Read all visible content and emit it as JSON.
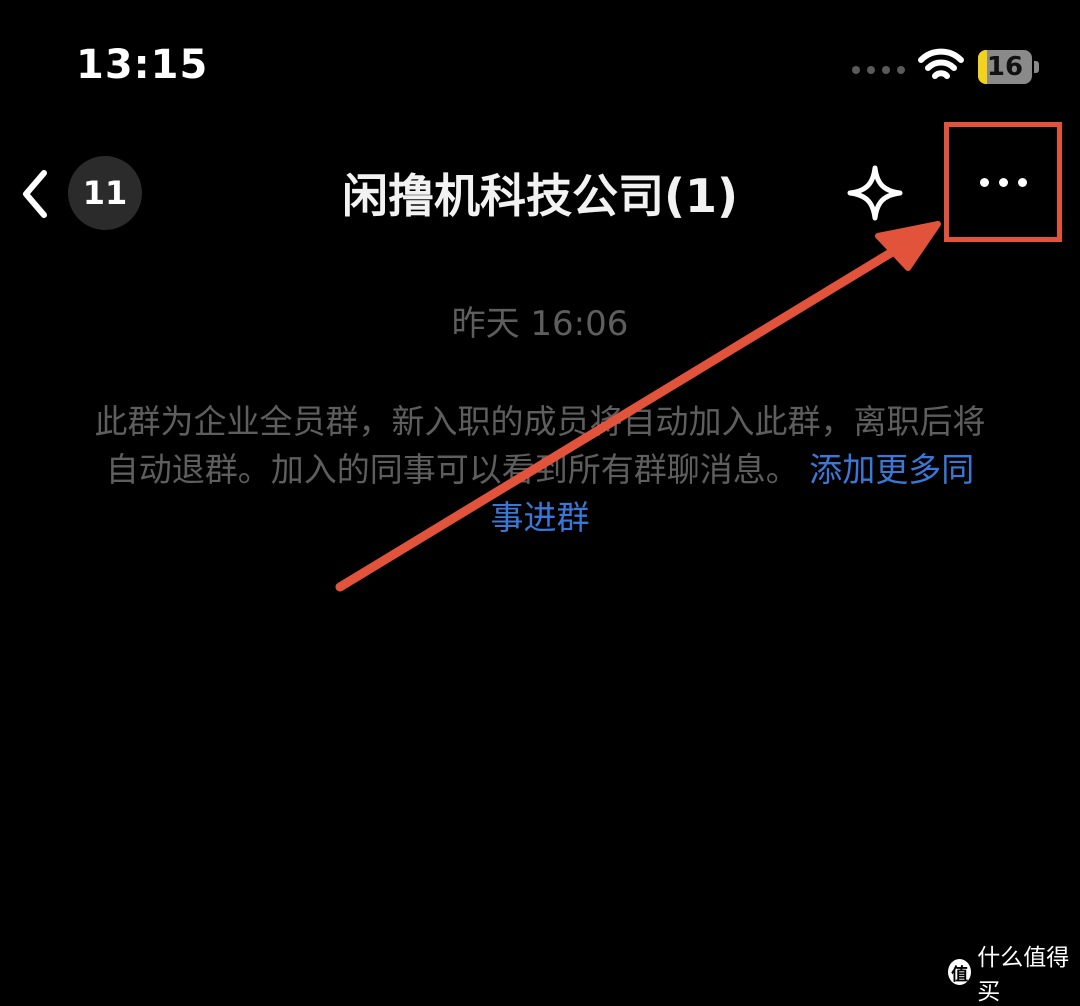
{
  "status_bar": {
    "time": "13:15",
    "battery_level": "16",
    "battery_fill_percent": 16,
    "icons": [
      "signal-dots-icon",
      "wifi-icon",
      "battery-icon"
    ]
  },
  "nav": {
    "back_icon": "chevron-left-icon",
    "unread_count": "11",
    "title": "闲撸机科技公司(1)",
    "sparkle_icon": "sparkle-icon",
    "more_icon": "more-dots-icon"
  },
  "chat": {
    "timestamp": "昨天 16:06",
    "notice_text": "此群为企业全员群，新入职的成员将自动加入此群，离职后将自动退群。加入的同事可以看到所有群聊消息。",
    "notice_link": "添加更多同事进群"
  },
  "annotation": {
    "highlight_color": "#e2533c"
  },
  "watermark": {
    "logo_char": "值",
    "text": "什么值得买"
  },
  "colors": {
    "background": "#000000",
    "muted_text": "#5e5e5e",
    "link": "#3a78d8",
    "battery_fill": "#f2d21b"
  }
}
